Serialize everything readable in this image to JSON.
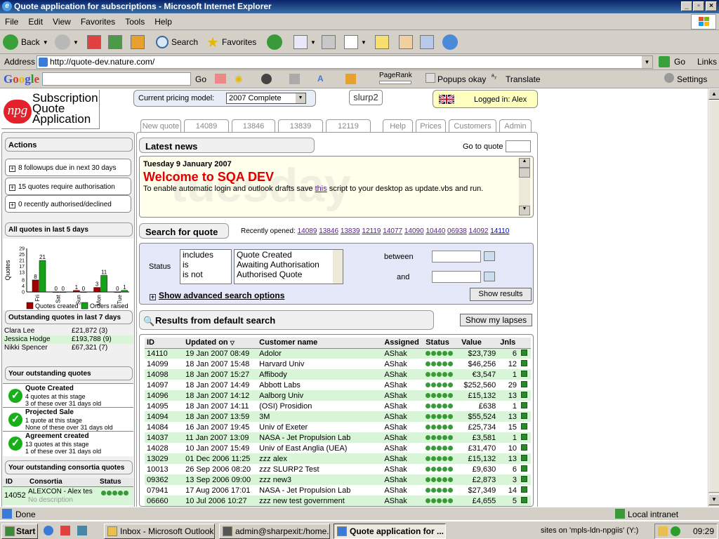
{
  "window": {
    "title": "Quote application for subscriptions - Microsoft Internet Explorer"
  },
  "menu": [
    "File",
    "Edit",
    "View",
    "Favorites",
    "Tools",
    "Help"
  ],
  "toolbar": {
    "back": "Back",
    "search": "Search",
    "favorites": "Favorites"
  },
  "address": {
    "label": "Address",
    "url": "http://quote-dev.nature.com/",
    "go": "Go",
    "links": "Links"
  },
  "googlebar": {
    "go": "Go",
    "pagerank": "PageRank",
    "popups": "Popups okay",
    "translate": "Translate",
    "settings": "Settings"
  },
  "app": {
    "logo_lines": [
      "Subscription",
      "Quote",
      "Application"
    ],
    "logo_badge": "npg",
    "pricing_label": "Current pricing model:",
    "pricing_value": "2007 Complete",
    "slurp": "slurp2",
    "logged_in": "Logged in: Alex",
    "tabs": [
      "New quote",
      "14089",
      "13846",
      "13839",
      "12119",
      "Help",
      "Prices",
      "Customers",
      "Admin"
    ]
  },
  "actions": {
    "title": "Actions",
    "items": [
      "8 followups due in next 30 days",
      "15 quotes require authorisation",
      "0 recently authorised/declined"
    ]
  },
  "quotes_chart": {
    "title": "All quotes in last 5 days"
  },
  "chart_data": {
    "type": "bar",
    "categories": [
      "Fri",
      "Sat",
      "Sun",
      "Mon",
      "Tue"
    ],
    "ylabel": "Quotes",
    "yticks": [
      0,
      4,
      8,
      13,
      17,
      21,
      25,
      29
    ],
    "ylim": [
      0,
      29
    ],
    "series": [
      {
        "name": "Quotes created",
        "color": "#a00000",
        "values": [
          8,
          0,
          1,
          3,
          0
        ]
      },
      {
        "name": "Orders raised",
        "color": "#18a018",
        "values": [
          21,
          0,
          0,
          11,
          1
        ]
      }
    ],
    "legend": "bottom"
  },
  "outstanding7": {
    "title": "Outstanding quotes in last 7 days",
    "rows": [
      {
        "name": "Clara Lee",
        "amount": "£21,872 (3)"
      },
      {
        "name": "Jessica Hodge",
        "amount": "£193,788 (9)"
      },
      {
        "name": "Nikki Spencer",
        "amount": "£67,321 (7)"
      }
    ]
  },
  "your_outstanding": {
    "title": "Your outstanding quotes",
    "items": [
      {
        "stage": "Quote Created",
        "l1": "4 quotes at this stage",
        "l2": "3 of these over 31 days old"
      },
      {
        "stage": "Projected Sale",
        "l1": "1 quote at this stage",
        "l2": "None of these over 31 days old"
      },
      {
        "stage": "Agreement created",
        "l1": "13 quotes at this stage",
        "l2": "1 of these over 31 days old"
      }
    ]
  },
  "consortia": {
    "title": "Your outstanding consortia quotes",
    "headers": [
      "ID",
      "Consortia",
      "Status"
    ],
    "row": {
      "id": "14052",
      "name": "ALEXCON - Alex tes",
      "desc": "No description"
    }
  },
  "news": {
    "title": "Latest news",
    "goto_label": "Go to quote",
    "date": "Tuesday 9 January 2007",
    "headline": "Welcome to SQA DEV",
    "body_pre": "To enable automatic login and outlook drafts save ",
    "body_link": "this",
    "body_post": " script to your desktop as update.vbs and run.",
    "watermark": "tuesday"
  },
  "search": {
    "title": "Search for quote",
    "recent_label": "Recently opened:",
    "recent": [
      "14089",
      "13846",
      "13839",
      "12119",
      "14077",
      "14090",
      "10440",
      "06938",
      "14092",
      "14110"
    ],
    "status_label": "Status",
    "ops": [
      "includes",
      "is",
      "is not"
    ],
    "statuses": [
      "Quote Created",
      "Awaiting Authorisation",
      "Authorised Quote"
    ],
    "between": "between",
    "and": "and",
    "advanced": "Show advanced search options",
    "show_results": "Show results"
  },
  "results": {
    "title": "Results from default search",
    "lapses_btn": "Show my lapses",
    "headers": [
      "ID",
      "Updated on",
      "Customer name",
      "Assigned",
      "Status",
      "Value",
      "Jnls"
    ],
    "rows": [
      [
        "14110",
        "19 Jan 2007 08:49",
        "Adolor",
        "AShak",
        "$23,739",
        "6"
      ],
      [
        "14099",
        "18 Jan 2007 15:48",
        "Harvard Univ",
        "AShak",
        "$46,256",
        "12"
      ],
      [
        "14098",
        "18 Jan 2007 15:27",
        "Affibody",
        "AShak",
        "€3,547",
        "1"
      ],
      [
        "14097",
        "18 Jan 2007 14:49",
        "Abbott Labs",
        "AShak",
        "$252,560",
        "29"
      ],
      [
        "14096",
        "18 Jan 2007 14:12",
        "Aalborg Univ",
        "AShak",
        "£15,132",
        "13"
      ],
      [
        "14095",
        "18 Jan 2007 14:11",
        "(OSI) Prosidion",
        "AShak",
        "£638",
        "1"
      ],
      [
        "14094",
        "18 Jan 2007 13:59",
        "3M",
        "AShak",
        "$55,524",
        "13"
      ],
      [
        "14084",
        "16 Jan 2007 19:45",
        "Univ of Exeter",
        "AShak",
        "£25,734",
        "15"
      ],
      [
        "14037",
        "11 Jan 2007 13:09",
        "NASA - Jet Propulsion Lab",
        "AShak",
        "£3,581",
        "1"
      ],
      [
        "14028",
        "10 Jan 2007 15:49",
        "Univ of East Anglia (UEA)",
        "AShak",
        "£31,470",
        "10"
      ],
      [
        "13029",
        "01 Dec 2006 11:25",
        "zzz alex",
        "AShak",
        "£15,132",
        "13"
      ],
      [
        "10013",
        "26 Sep 2006 08:20",
        "zzz SLURP2 Test",
        "AShak",
        "£9,630",
        "6"
      ],
      [
        "09362",
        "13 Sep 2006 09:00",
        "zzz new3",
        "AShak",
        "£2,873",
        "3"
      ],
      [
        "07941",
        "17 Aug 2006 17:01",
        "NASA - Jet Propulsion Lab",
        "AShak",
        "$27,349",
        "14"
      ],
      [
        "06660",
        "10 Jul 2006 10:27",
        "zzz new test government",
        "AShak",
        "£4,655",
        "5"
      ]
    ]
  },
  "status": {
    "left": "Done",
    "zone": "Local intranet"
  },
  "taskbar": {
    "start": "Start",
    "tasks": [
      "Inbox - Microsoft Outlook",
      "admin@sharpexit:/home...",
      "Quote application for ..."
    ],
    "tray_text": "sites on 'mpls-ldn-npgiis' (Y:)",
    "time": "09:29"
  }
}
